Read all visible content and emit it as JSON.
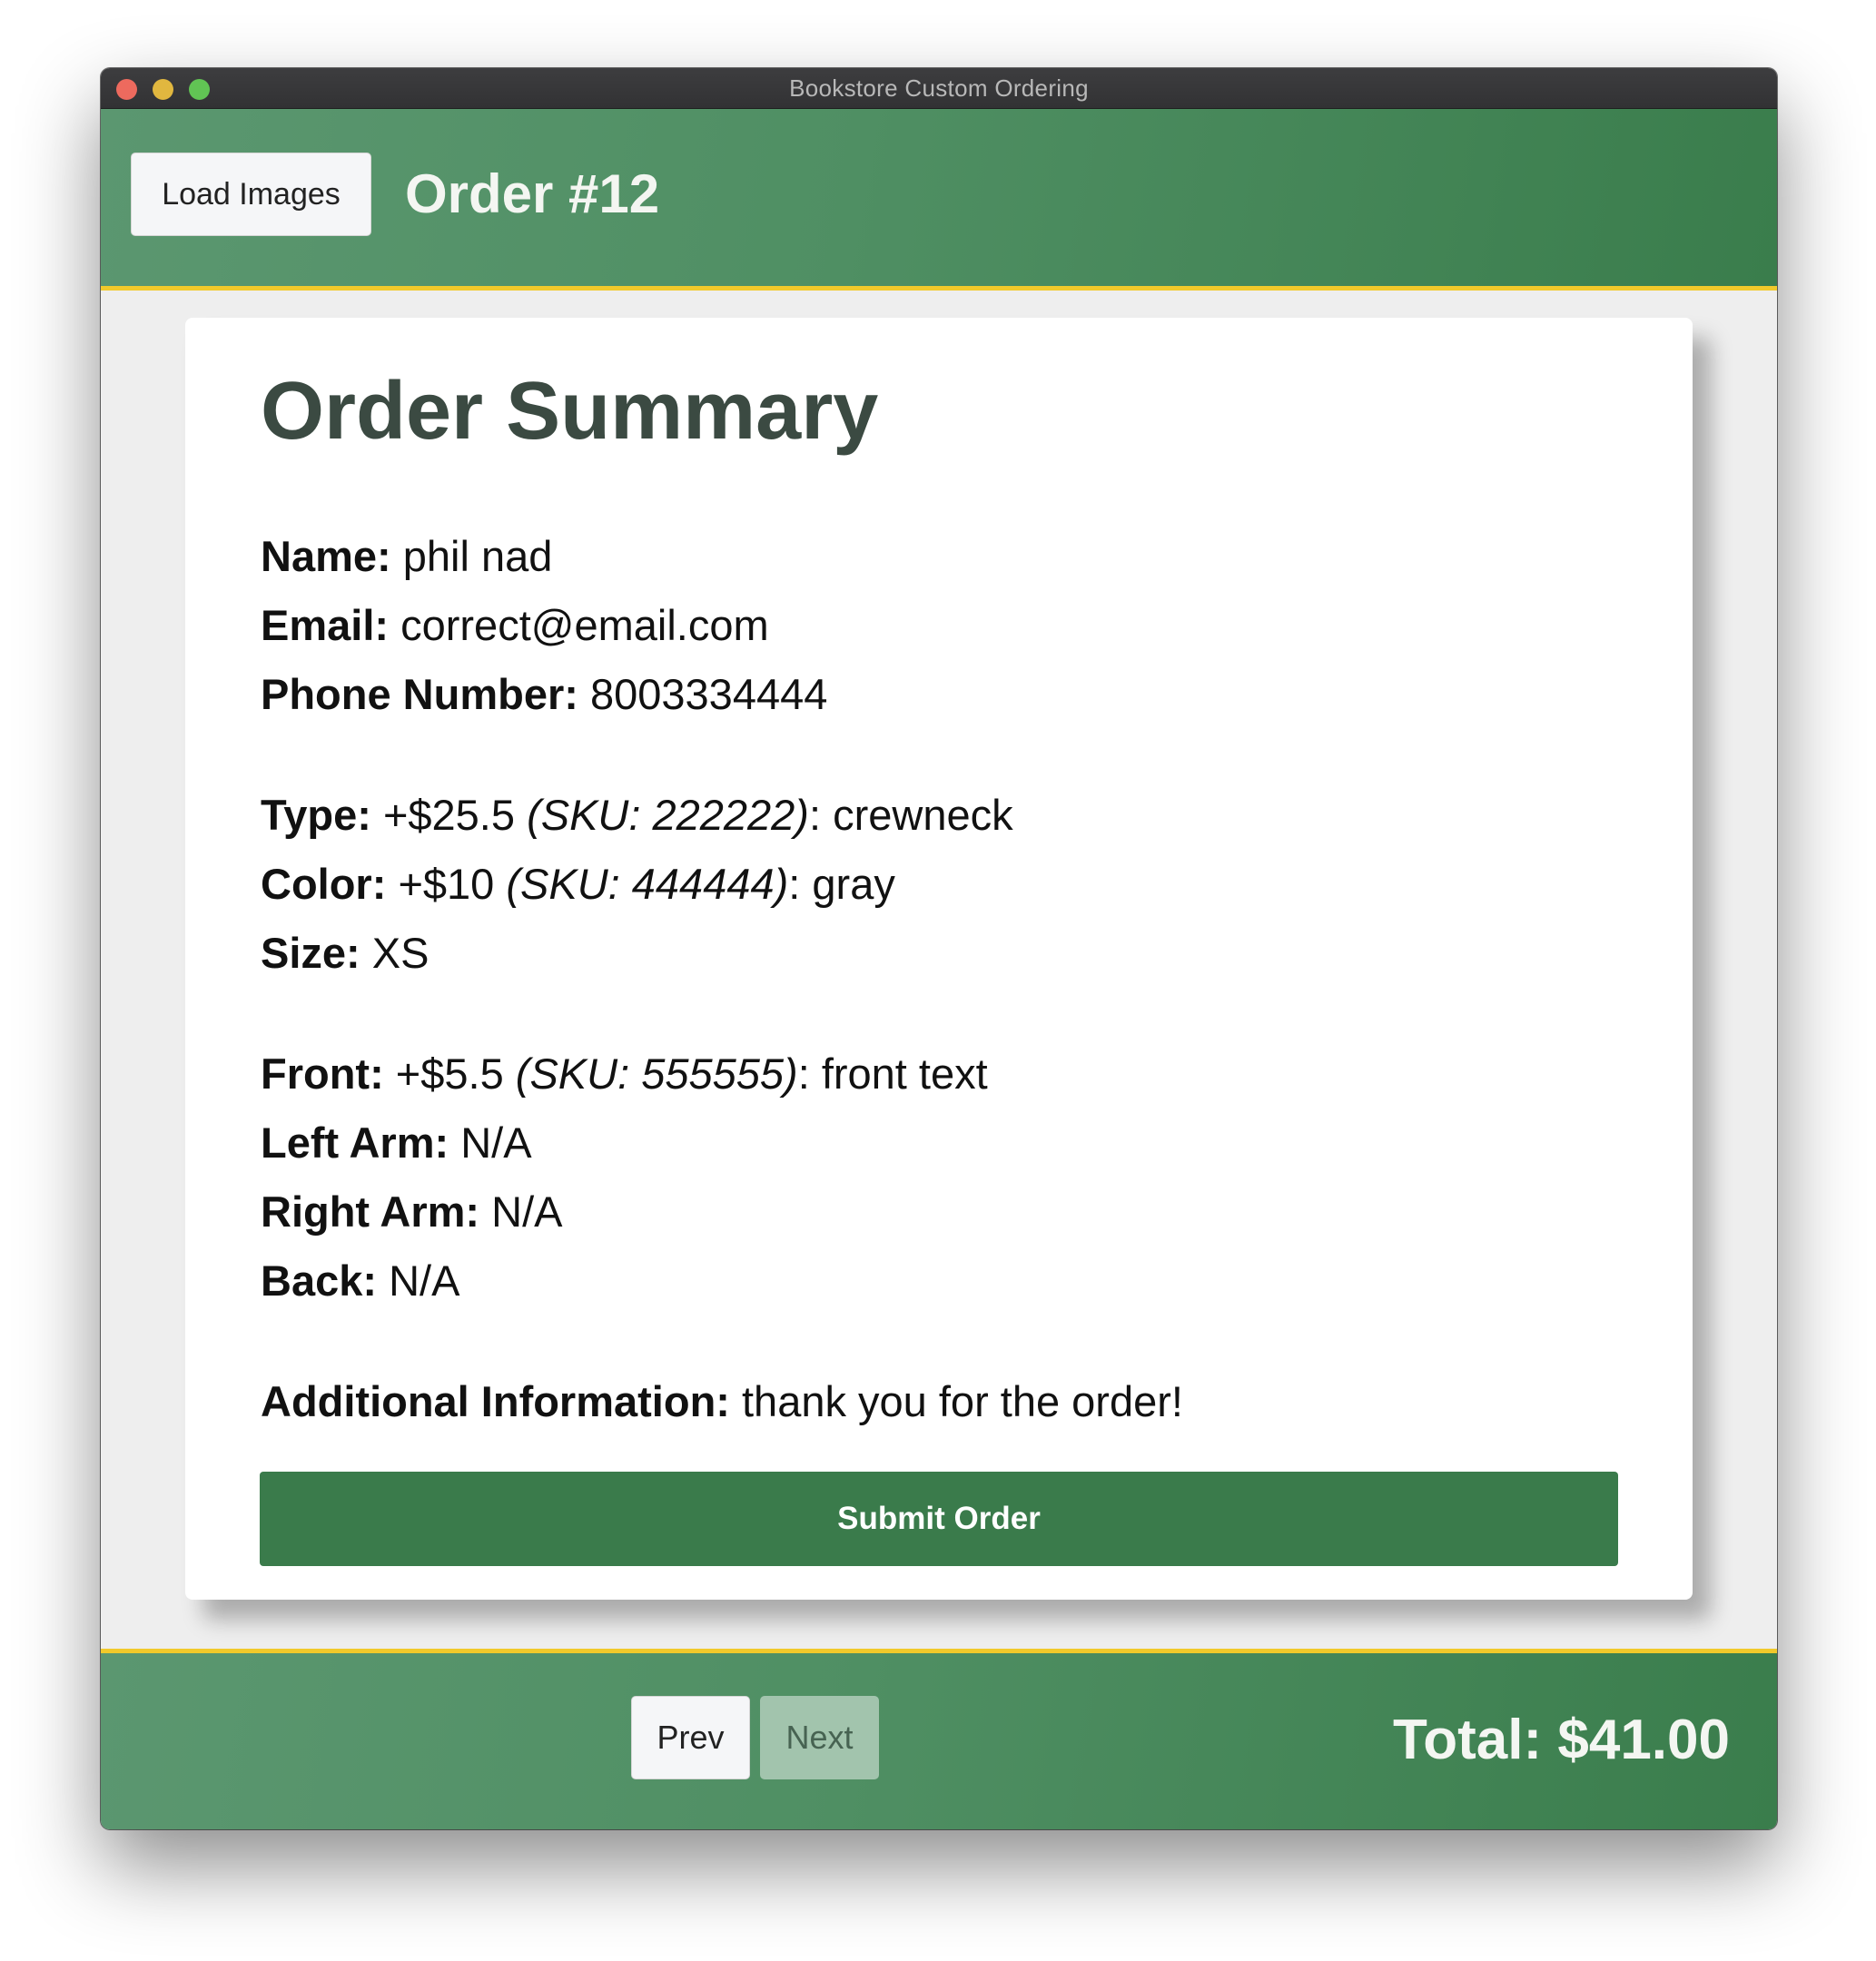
{
  "window": {
    "title": "Bookstore Custom Ordering"
  },
  "header": {
    "load_images_label": "Load Images",
    "order_title": "Order #12"
  },
  "summary": {
    "title": "Order Summary",
    "name": {
      "label": "Name:",
      "value": "phil nad"
    },
    "email": {
      "label": "Email:",
      "value": "correct@email.com"
    },
    "phone": {
      "label": "Phone Number:",
      "value": "8003334444"
    },
    "type": {
      "label": "Type:",
      "price": "+$25.5",
      "sku": "(SKU: 222222)",
      "value": ": crewneck"
    },
    "color": {
      "label": "Color:",
      "price": "+$10",
      "sku": "(SKU: 444444)",
      "value": ": gray"
    },
    "size": {
      "label": "Size:",
      "value": "XS"
    },
    "front": {
      "label": "Front:",
      "price": "+$5.5",
      "sku": "(SKU: 555555)",
      "value": ": front text"
    },
    "left_arm": {
      "label": "Left Arm:",
      "value": "N/A"
    },
    "right_arm": {
      "label": "Right Arm:",
      "value": "N/A"
    },
    "back": {
      "label": "Back:",
      "value": "N/A"
    },
    "additional": {
      "label": "Additional Information:",
      "value": "thank you for the order!"
    },
    "submit_label": "Submit Order"
  },
  "footer": {
    "prev_label": "Prev",
    "next_label": "Next",
    "total_text": "Total: $41.00"
  },
  "colors": {
    "header_green": "#4f8f63",
    "accent_yellow": "#f1c92b",
    "submit_green": "#3a7b4b",
    "next_disabled": "#a2c4ad"
  }
}
